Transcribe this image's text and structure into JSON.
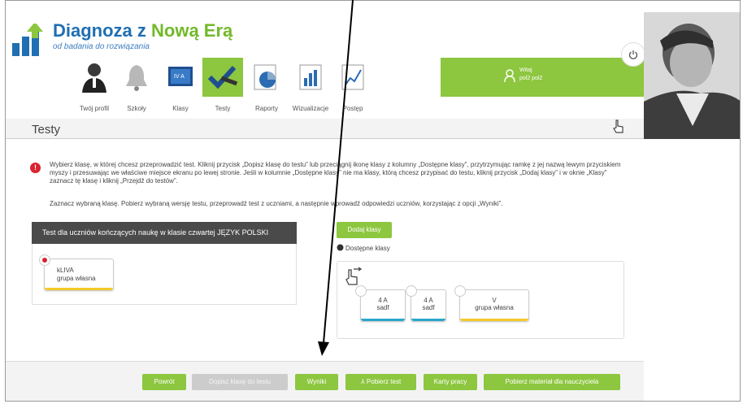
{
  "logo": {
    "title_main": "Diagnoza z ",
    "title_accent": "Nową Erą",
    "subtitle": "od badania do rozwiązania"
  },
  "nav": {
    "items": [
      {
        "label": "Twój profil",
        "icon": "profile-icon"
      },
      {
        "label": "Szkoły",
        "icon": "bell-icon"
      },
      {
        "label": "Klasy",
        "icon": "class-board-icon"
      },
      {
        "label": "Testy",
        "icon": "checkmark-pen-icon",
        "active": true
      },
      {
        "label": "Raporty",
        "icon": "pie-chart-icon"
      },
      {
        "label": "Wizualizacje",
        "icon": "bar-chart-icon"
      },
      {
        "label": "Postęp",
        "icon": "line-chart-icon"
      }
    ]
  },
  "user": {
    "greeting": "Witaj",
    "name": "pol2 pol2"
  },
  "page": {
    "title": "Testy"
  },
  "info": {
    "paragraph1": "Wybierz klasę, w której chcesz przeprowadzić test. Kliknij przycisk „Dopisz klasę do testu” lub przeciągnij ikonę klasy z kolumny „Dostępne klasy”, przytrzymując ramkę z jej nazwą lewym przyciskiem myszy i przesuwając we właściwe miejsce ekranu po lewej stronie. Jeśli w kolumnie „Dostępne klasy” nie ma klasy, którą chcesz przypisać do testu, kliknij przycisk „Dodaj klasy” i w oknie „Klasy” zaznacz tę klasę i kliknij „Przejdź do testów”.",
    "paragraph2": "Zaznacz wybraną klasę. Pobierz wybraną wersję testu, przeprowadź test z uczniami, a następnie wprowadź odpowiedzi uczniów, korzystając z opcji „Wyniki”."
  },
  "test_panel": {
    "header": "Test dla uczniów kończących naukę w klasie czwartej JĘZYK POLSKI",
    "assigned_class": {
      "name": "kLIVA",
      "group": "grupa własna"
    }
  },
  "available": {
    "add_button": "Dodaj klasy",
    "label": "Dostępne klasy",
    "classes": [
      {
        "name": "4 A",
        "group": "sadf"
      },
      {
        "name": "4 A",
        "group": "sadf"
      },
      {
        "name": "V",
        "group": "grupa własna"
      }
    ]
  },
  "footer": {
    "back": "Powrót",
    "assign": "Dopisz klasę do testu",
    "results": "Wyniki",
    "download_test": "Pobierz test",
    "worksheets": "Karty pracy",
    "teacher_material": "Pobierz materiał dla nauczyciela"
  },
  "colors": {
    "accent": "#8dc63f",
    "brand_blue": "#1f6fb2",
    "alert": "#d9232d",
    "header_dark": "#4a4a4a"
  }
}
